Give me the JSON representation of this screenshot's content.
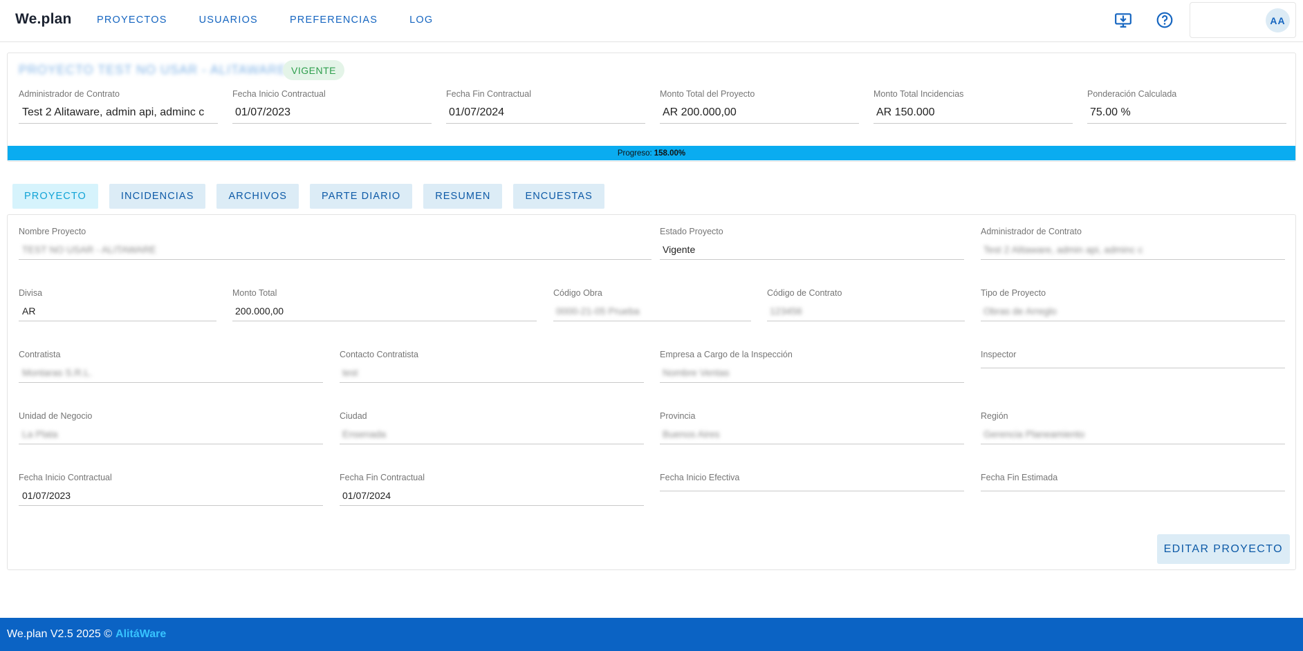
{
  "app": {
    "logo": "We.plan",
    "nav": [
      "PROYECTOS",
      "USUARIOS",
      "PREFERENCIAS",
      "LOG"
    ],
    "icons": [
      "download-monitor-icon",
      "help-circle-icon"
    ],
    "user_initials": "AA",
    "accent": "#1565c0"
  },
  "project": {
    "title": "PROYECTO TEST NO USAR - ALITAWARE",
    "status_badge": "VIGENTE",
    "header_fields": [
      {
        "label": "Administrador de Contrato",
        "value": "Test 2 Alitaware, admin api, adminc c"
      },
      {
        "label": "Fecha Inicio Contractual",
        "value": "01/07/2023"
      },
      {
        "label": "Fecha Fin Contractual",
        "value": "01/07/2024"
      },
      {
        "label": "Monto Total del Proyecto",
        "value": "AR 200.000,00"
      },
      {
        "label": "Monto Total Incidencias",
        "value": "AR 150.000"
      },
      {
        "label": "Ponderación Calculada",
        "value": "75.00 %"
      }
    ],
    "progress_label": "Progreso:",
    "progress_value": "158.00%",
    "progress_color": "#0aacf0"
  },
  "tabs": [
    "PROYECTO",
    "INCIDENCIAS",
    "ARCHIVOS",
    "PARTE DIARIO",
    "RESUMEN",
    "ENCUESTAS"
  ],
  "active_tab": "PROYECTO",
  "details": {
    "nombre_proyecto": {
      "label": "Nombre Proyecto",
      "value": "TEST NO USAR - ALITAWARE"
    },
    "estado_proyecto": {
      "label": "Estado Proyecto",
      "value": "Vigente"
    },
    "administrador": {
      "label": "Administrador de Contrato",
      "value": "Test 2 Alitaware, admin api, adminc c"
    },
    "divisa": {
      "label": "Divisa",
      "value": "AR"
    },
    "monto_total": {
      "label": "Monto Total",
      "value": "200.000,00"
    },
    "codigo_obra": {
      "label": "Código Obra",
      "value": "0000-21-05 Prueba"
    },
    "codigo_contrato": {
      "label": "Código de Contrato",
      "value": "123456"
    },
    "tipo_proyecto": {
      "label": "Tipo de Proyecto",
      "value": "Obras de Arreglo"
    },
    "contratista": {
      "label": "Contratista",
      "value": "Montaras S.R.L."
    },
    "contacto_contratista": {
      "label": "Contacto Contratista",
      "value": "test"
    },
    "empresa_inspeccion": {
      "label": "Empresa a Cargo de la Inspección",
      "value": "Nombre Ventas"
    },
    "inspector": {
      "label": "Inspector",
      "value": ""
    },
    "unidad_negocio": {
      "label": "Unidad de Negocio",
      "value": "La Plata"
    },
    "ciudad": {
      "label": "Ciudad",
      "value": "Ensenada"
    },
    "provincia": {
      "label": "Provincia",
      "value": "Buenos Aires"
    },
    "region": {
      "label": "Región",
      "value": "Gerencia Planeamiento"
    },
    "fecha_inicio_contractual": {
      "label": "Fecha Inicio Contractual",
      "value": "01/07/2023"
    },
    "fecha_fin_contractual": {
      "label": "Fecha Fin Contractual",
      "value": "01/07/2024"
    },
    "fecha_inicio_efectiva": {
      "label": "Fecha Inicio Efectiva",
      "value": ""
    },
    "fecha_fin_estimada": {
      "label": "Fecha Fin Estimada",
      "value": ""
    }
  },
  "edit_button": "EDITAR PROYECTO",
  "footer": {
    "text": "We.plan V2.5 2025 ©",
    "brand": "AlitáWare"
  }
}
